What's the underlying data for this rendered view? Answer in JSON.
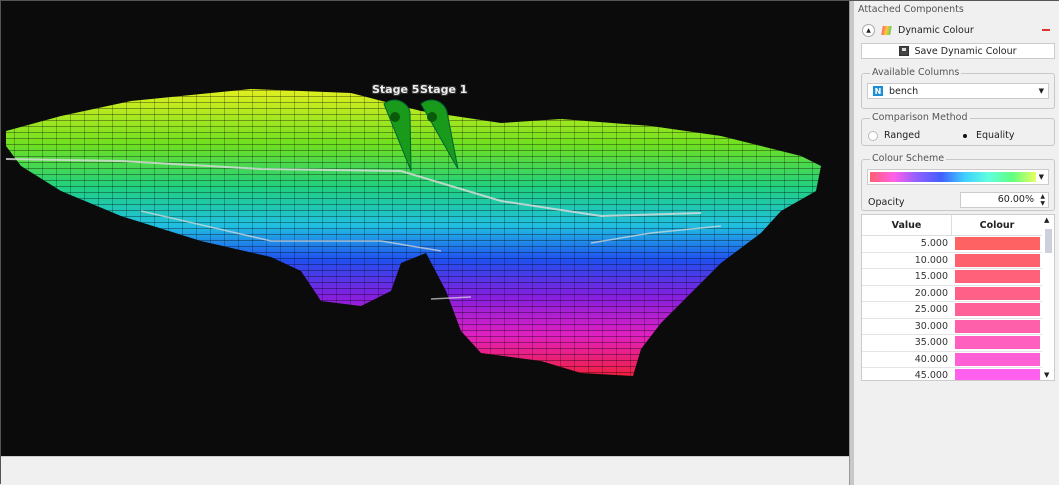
{
  "viewport": {
    "labels": [
      "Stage 5",
      "Stage 1"
    ],
    "colors": {
      "background": "#0b0b0b",
      "marker": "#1a9a1a"
    }
  },
  "panel": {
    "header": "Attached Components",
    "component": {
      "name": "Dynamic Colour",
      "icon": "dynamic-colour-icon"
    },
    "save_label": "Save Dynamic Colour",
    "available_columns": {
      "title": "Available Columns",
      "selected": "bench",
      "type_badge": "N"
    },
    "comparison": {
      "title": "Comparison Method",
      "options": [
        "Ranged",
        "Equality"
      ],
      "selected": "Equality"
    },
    "colour_scheme": {
      "title": "Colour Scheme",
      "opacity_label": "Opacity",
      "opacity_value": "60.00%"
    },
    "table": {
      "headers": [
        "Value",
        "Colour"
      ],
      "rows": [
        {
          "value": "5.000",
          "colour": "#ff6262"
        },
        {
          "value": "10.000",
          "colour": "#ff606e"
        },
        {
          "value": "15.000",
          "colour": "#ff607a"
        },
        {
          "value": "20.000",
          "colour": "#ff6088"
        },
        {
          "value": "25.000",
          "colour": "#ff6098"
        },
        {
          "value": "30.000",
          "colour": "#ff60aa"
        },
        {
          "value": "35.000",
          "colour": "#ff60c0"
        },
        {
          "value": "40.000",
          "colour": "#ff60d6"
        },
        {
          "value": "45.000",
          "colour": "#ff60ee"
        }
      ]
    }
  }
}
